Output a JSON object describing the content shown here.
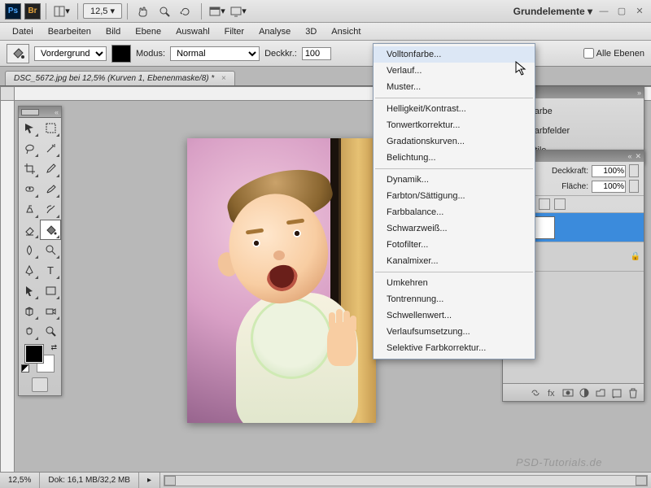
{
  "app_bar": {
    "zoom_display": "12,5",
    "workspace": "Grundelemente ▾"
  },
  "menu": [
    "Datei",
    "Bearbeiten",
    "Bild",
    "Ebene",
    "Auswahl",
    "Filter",
    "Analyse",
    "3D",
    "Ansicht"
  ],
  "options": {
    "fill_source_label": "Vordergrund",
    "mode_label": "Modus:",
    "mode_value": "Normal",
    "opacity_label": "Deckkr.:",
    "opacity_value": "100",
    "all_layers_label": "Alle Ebenen"
  },
  "doc_tab": "DSC_5672.jpg bei 12,5% (Kurven 1, Ebenenmaske/8) *",
  "dropdown": {
    "groups": [
      [
        "Volltonfarbe...",
        "Verlauf...",
        "Muster..."
      ],
      [
        "Helligkeit/Kontrast...",
        "Tonwertkorrektur...",
        "Gradationskurven...",
        "Belichtung..."
      ],
      [
        "Dynamik...",
        "Farbton/Sättigung...",
        "Farbbalance...",
        "Schwarzweiß...",
        "Fotofilter...",
        "Kanalmixer..."
      ],
      [
        "Umkehren",
        "Tontrennung...",
        "Schwellenwert...",
        "Verlaufsumsetzung...",
        "Selektive Farbkorrektur..."
      ]
    ],
    "highlighted": "Volltonfarbe..."
  },
  "right_tabs": [
    "Farbe",
    "Farbfelder",
    "Stile"
  ],
  "layers": {
    "opacity_label": "Deckkraft:",
    "opacity_value": "100%",
    "fill_label": "Fläche:",
    "fill_value": "100%"
  },
  "status": {
    "zoom": "12,5%",
    "doc_size": "Dok: 16,1 MB/32,2 MB"
  },
  "watermark": "PSD-Tutorials.de"
}
